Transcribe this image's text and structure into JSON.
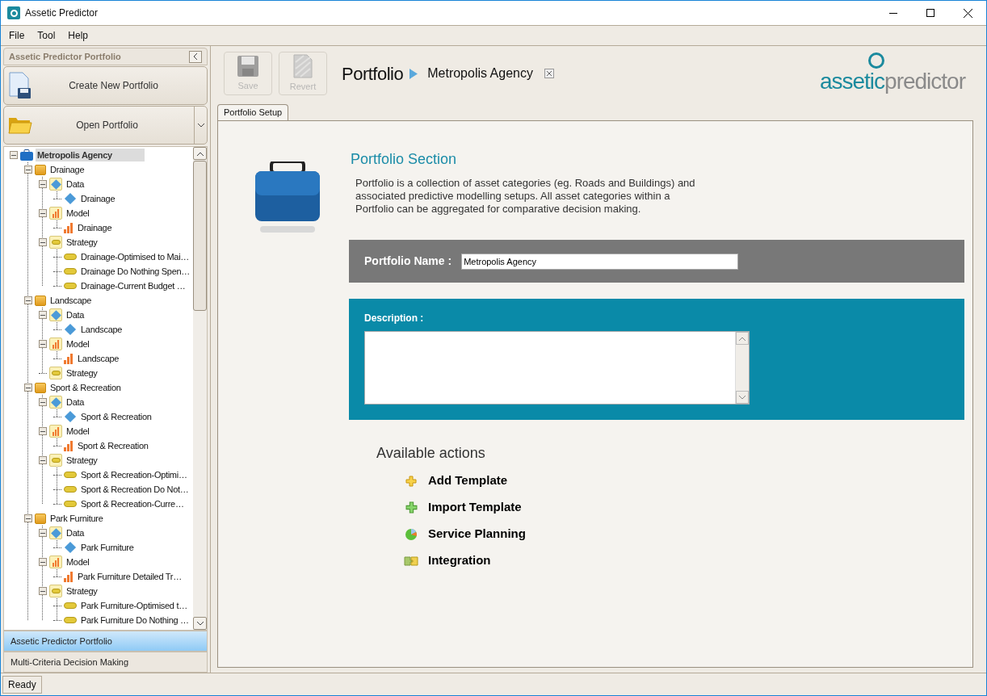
{
  "window": {
    "title": "Assetic Predictor"
  },
  "menu": [
    "File",
    "Tool",
    "Help"
  ],
  "sidebar": {
    "title": "Assetic Predictor Portfolio",
    "buttons": [
      {
        "label": "Create New Portfolio",
        "kind": "create"
      },
      {
        "label": "Open Portfolio",
        "kind": "open"
      }
    ],
    "tree": [
      {
        "label": "Metropolis Agency",
        "kind": "root",
        "expanded": true,
        "selected": true,
        "children": [
          {
            "label": "Drainage",
            "kind": "category",
            "expanded": true,
            "selected": false,
            "children": [
              {
                "label": "Data",
                "kind": "data",
                "expanded": true,
                "selected": false,
                "children": [
                  {
                    "label": "Drainage",
                    "kind": "dataset",
                    "selected": false
                  }
                ]
              },
              {
                "label": "Model",
                "kind": "model",
                "expanded": true,
                "selected": false,
                "children": [
                  {
                    "label": "Drainage",
                    "kind": "modelitem",
                    "selected": false
                  }
                ]
              },
              {
                "label": "Strategy",
                "kind": "strategy",
                "expanded": true,
                "selected": false,
                "children": [
                  {
                    "label": "Drainage-Optimised to Mai…",
                    "kind": "strategyitem",
                    "selected": false
                  },
                  {
                    "label": "Drainage Do Nothing Spen…",
                    "kind": "strategyitem",
                    "selected": false
                  },
                  {
                    "label": "Drainage-Current Budget …",
                    "kind": "strategyitem",
                    "selected": false
                  }
                ]
              }
            ]
          },
          {
            "label": "Landscape",
            "kind": "category",
            "expanded": true,
            "selected": false,
            "children": [
              {
                "label": "Data",
                "kind": "data",
                "expanded": true,
                "selected": false,
                "children": [
                  {
                    "label": "Landscape",
                    "kind": "dataset",
                    "selected": false
                  }
                ]
              },
              {
                "label": "Model",
                "kind": "model",
                "expanded": true,
                "selected": false,
                "children": [
                  {
                    "label": "Landscape",
                    "kind": "modelitem",
                    "selected": false
                  }
                ]
              },
              {
                "label": "Strategy",
                "kind": "strategy",
                "selected": false
              }
            ]
          },
          {
            "label": "Sport & Recreation",
            "kind": "category",
            "expanded": true,
            "selected": false,
            "children": [
              {
                "label": "Data",
                "kind": "data",
                "expanded": true,
                "selected": false,
                "children": [
                  {
                    "label": "Sport & Recreation",
                    "kind": "dataset",
                    "selected": false
                  }
                ]
              },
              {
                "label": "Model",
                "kind": "model",
                "expanded": true,
                "selected": false,
                "children": [
                  {
                    "label": "Sport & Recreation",
                    "kind": "modelitem",
                    "selected": false
                  }
                ]
              },
              {
                "label": "Strategy",
                "kind": "strategy",
                "expanded": true,
                "selected": false,
                "children": [
                  {
                    "label": "Sport & Recreation-Optimi…",
                    "kind": "strategyitem",
                    "selected": false
                  },
                  {
                    "label": "Sport & Recreation Do Not…",
                    "kind": "strategyitem",
                    "selected": false
                  },
                  {
                    "label": "Sport & Recreation-Curre…",
                    "kind": "strategyitem",
                    "selected": false
                  }
                ]
              }
            ]
          },
          {
            "label": "Park Furniture",
            "kind": "category",
            "expanded": true,
            "selected": false,
            "children": [
              {
                "label": "Data",
                "kind": "data",
                "expanded": true,
                "selected": false,
                "children": [
                  {
                    "label": "Park Furniture",
                    "kind": "dataset",
                    "selected": false
                  }
                ]
              },
              {
                "label": "Model",
                "kind": "model",
                "expanded": true,
                "selected": false,
                "children": [
                  {
                    "label": "Park Furniture Detailed Tr…",
                    "kind": "modelitem",
                    "selected": false
                  }
                ]
              },
              {
                "label": "Strategy",
                "kind": "strategy",
                "expanded": true,
                "selected": false,
                "children": [
                  {
                    "label": "Park Furniture-Optimised t…",
                    "kind": "strategyitem",
                    "selected": false
                  },
                  {
                    "label": "Park Furniture Do Nothing …",
                    "kind": "strategyitem",
                    "selected": false
                  }
                ]
              }
            ]
          }
        ]
      }
    ],
    "nav": [
      {
        "label": "Assetic Predictor Portfolio",
        "selected": true
      },
      {
        "label": "Multi-Criteria Decision Making",
        "selected": false
      }
    ]
  },
  "toolbar": {
    "buttons": [
      {
        "label": "Save",
        "kind": "save",
        "disabled": true
      },
      {
        "label": "Revert",
        "kind": "revert",
        "disabled": true
      }
    ],
    "breadcrumb": [
      "Portfolio",
      "Metropolis Agency"
    ],
    "logo": [
      "assetic",
      "predictor"
    ]
  },
  "tabs": [
    {
      "label": "Portfolio Setup",
      "selected": true
    }
  ],
  "section": {
    "title": "Portfolio Section",
    "description": "Portfolio is a collection of asset categories (eg. Roads and Buildings) and associated predictive modelling setups. All asset categories within a Portfolio can be aggregated for comparative decision making.",
    "name_label": "Portfolio Name :",
    "name_value": "Metropolis Agency",
    "description_label": "Description :"
  },
  "actions": {
    "title": "Available actions",
    "items": [
      {
        "label": "Add Template",
        "kind": "add"
      },
      {
        "label": "Import Template",
        "kind": "import"
      },
      {
        "label": "Service Planning",
        "kind": "planning"
      },
      {
        "label": "Integration",
        "kind": "integration"
      }
    ]
  },
  "status_bar": "Ready"
}
